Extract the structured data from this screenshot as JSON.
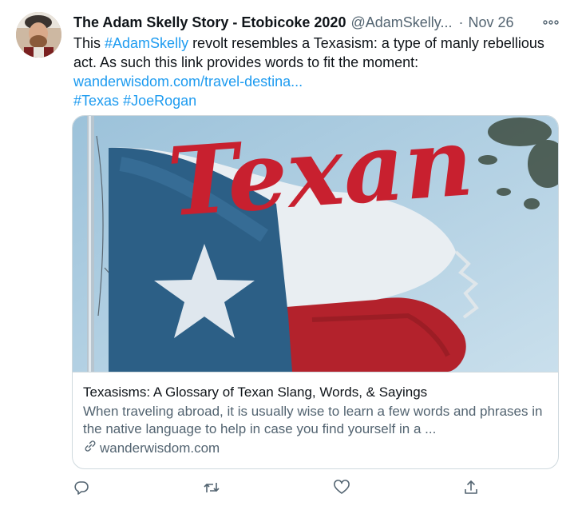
{
  "tweet": {
    "author_name": "The Adam Skelly Story - Etobicoke 2020",
    "handle": "@AdamSkelly...",
    "separator": "·",
    "date": "Nov 26",
    "more_label": "∘∘∘",
    "text": {
      "line1_prefix": "This ",
      "line1_hashtag": "#AdamSkelly",
      "line1_suffix": " revolt resembles a Texasism: a type of manly rebellious",
      "line2": "act. As such this link provides words to fit the moment:",
      "url": "wanderwisdom.com/travel-destina...",
      "hashtag_texas": "#Texas",
      "hashtag_joerogan": "#JoeRogan"
    }
  },
  "card": {
    "image_lettering": "Texan",
    "title": "Texasisms: A Glossary of Texan Slang, Words, & Sayings",
    "description": "When traveling abroad, it is usually wise to learn a few words and phrases in the native language to help in case you find yourself in a ...",
    "domain": "wanderwisdom.com"
  },
  "actions": [
    "reply-icon",
    "retweet-icon",
    "like-icon",
    "share-icon"
  ],
  "colors": {
    "link": "#1d9bf0",
    "secondary_text": "#536471",
    "border": "#cfd9de",
    "lettering_red": "#c8202f",
    "flag_blue": "#2c5f86",
    "flag_red": "#b3222c"
  }
}
